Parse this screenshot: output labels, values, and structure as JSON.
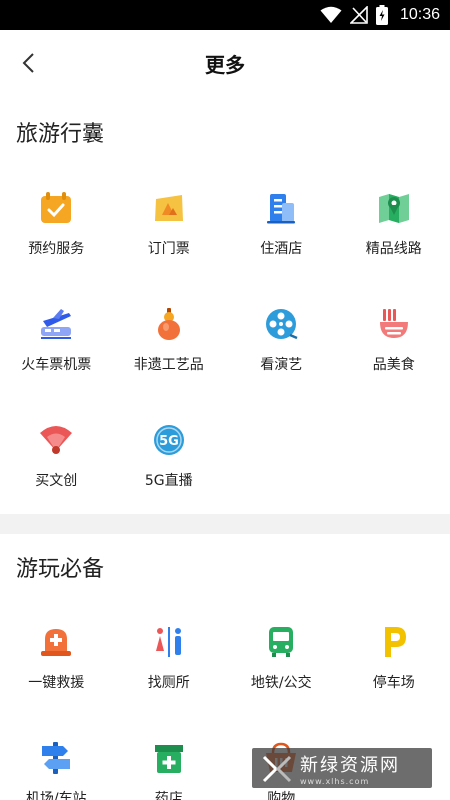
{
  "status_bar": {
    "time": "10:36"
  },
  "header": {
    "title": "更多"
  },
  "sections": [
    {
      "title": "旅游行囊",
      "items": [
        {
          "label": "预约服务",
          "icon": "calendar-check-icon"
        },
        {
          "label": "订门票",
          "icon": "ticket-icon"
        },
        {
          "label": "住酒店",
          "icon": "hotel-icon"
        },
        {
          "label": "精品线路",
          "icon": "map-pin-icon"
        },
        {
          "label": "火车票机票",
          "icon": "plane-train-icon"
        },
        {
          "label": "非遗工艺品",
          "icon": "gourd-icon"
        },
        {
          "label": "看演艺",
          "icon": "film-reel-icon"
        },
        {
          "label": "品美食",
          "icon": "food-bowl-icon"
        },
        {
          "label": "买文创",
          "icon": "fan-icon"
        },
        {
          "label": "5G直播",
          "icon": "5g-icon"
        }
      ]
    },
    {
      "title": "游玩必备",
      "items": [
        {
          "label": "一键救援",
          "icon": "rescue-icon"
        },
        {
          "label": "找厕所",
          "icon": "restroom-icon"
        },
        {
          "label": "地铁/公交",
          "icon": "bus-icon"
        },
        {
          "label": "停车场",
          "icon": "parking-icon"
        },
        {
          "label": "机场/车站",
          "icon": "signpost-icon"
        },
        {
          "label": "药店",
          "icon": "pharmacy-icon"
        },
        {
          "label": "购物",
          "icon": "shopping-basket-icon"
        }
      ]
    }
  ],
  "watermark": {
    "main": "新绿资源网",
    "sub": "www.xlhs.com"
  },
  "colors": {
    "orange": "#F5A623",
    "blue": "#2F80ED",
    "green": "#27AE60",
    "red": "#EB5757",
    "yellow": "#F2C200"
  }
}
